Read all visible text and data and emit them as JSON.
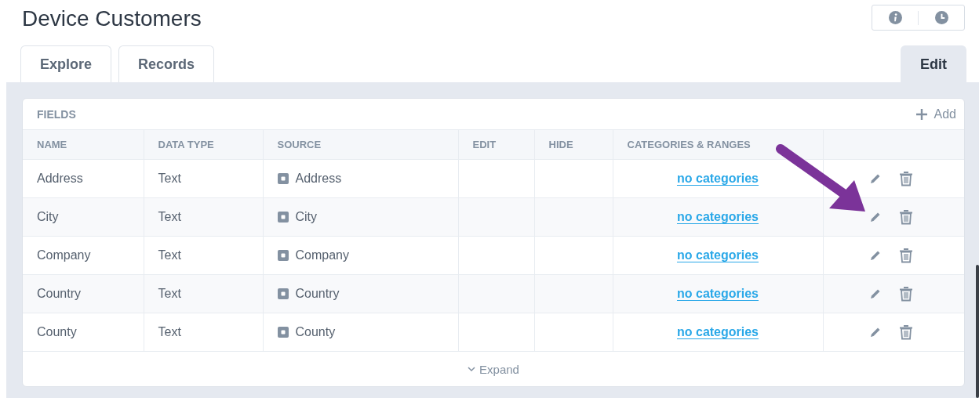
{
  "title": "Device Customers",
  "tabs": [
    {
      "label": "Explore",
      "selected": false
    },
    {
      "label": "Records",
      "selected": false
    }
  ],
  "right_tabs": [
    {
      "label": "Edit",
      "selected": true
    }
  ],
  "fields": {
    "heading": "FIELDS",
    "add_label": "Add",
    "columns": [
      "NAME",
      "DATA TYPE",
      "SOURCE",
      "EDIT",
      "HIDE",
      "CATEGORIES & RANGES"
    ],
    "rows": [
      {
        "name": "Address",
        "data_type": "Text",
        "source": "Address",
        "categories": "no categories"
      },
      {
        "name": "City",
        "data_type": "Text",
        "source": "City",
        "categories": "no categories"
      },
      {
        "name": "Company",
        "data_type": "Text",
        "source": "Company",
        "categories": "no categories"
      },
      {
        "name": "Country",
        "data_type": "Text",
        "source": "Country",
        "categories": "no categories"
      },
      {
        "name": "County",
        "data_type": "Text",
        "source": "County",
        "categories": "no categories"
      }
    ],
    "expand_label": "Expand"
  }
}
